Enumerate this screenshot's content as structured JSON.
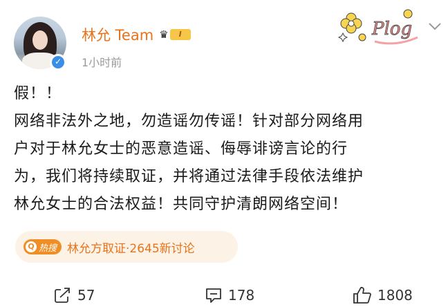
{
  "post": {
    "author": "林允 Team",
    "level_badge": "I",
    "time": "1小时前",
    "lines": [
      "假！！",
      "网络非法外之地，勿造谣勿传谣！针对部分网络用",
      "户对于林允女士的恶意造谣、侮辱诽谤言论的行",
      "为，我们将持续取证，并将通过法律手段依法维护",
      "林允女士的合法权益！共同守护清朗网络空间！"
    ],
    "decoration_text": "Plog"
  },
  "hot_search": {
    "logo_text": "热搜",
    "text": "林允方取证·2645新讨论"
  },
  "footer": {
    "reposts": "57",
    "comments": "178",
    "likes": "1808"
  },
  "colors": {
    "name": "#e8731a",
    "hot_bg": "#fdf2e6",
    "hot_accent": "#f08d24",
    "verified": "#3a8ee6"
  },
  "icons": [
    "verified-icon",
    "crown-icon",
    "chevron-down-icon",
    "hot-search-icon",
    "repost-icon",
    "comment-icon",
    "like-icon"
  ]
}
